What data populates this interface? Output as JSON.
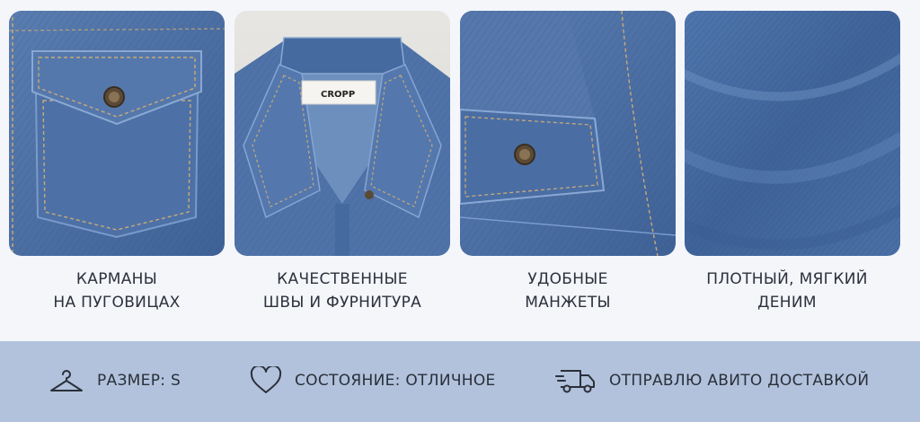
{
  "features": [
    {
      "icon": "pocket-image",
      "lines": [
        "КАРМАНЫ",
        "НА ПУГОВИЦАХ"
      ]
    },
    {
      "icon": "collar-image",
      "label_tag": "CROPP",
      "lines": [
        "КАЧЕСТВЕННЫЕ",
        "ШВЫ И ФУРНИТУРА"
      ]
    },
    {
      "icon": "cuff-image",
      "lines": [
        "УДОБНЫЕ",
        "МАНЖЕТЫ"
      ]
    },
    {
      "icon": "denim-texture-image",
      "lines": [
        "ПЛОТНЫЙ, МЯГКИЙ",
        "ДЕНИМ"
      ]
    }
  ],
  "info_bar": [
    {
      "icon": "hanger-icon",
      "text": "РАЗМЕР: S"
    },
    {
      "icon": "heart-icon",
      "text": "СОСТОЯНИЕ: ОТЛИЧНОЕ"
    },
    {
      "icon": "delivery-truck-icon",
      "text": "ОТПРАВЛЮ АВИТО ДОСТАВКОЙ"
    }
  ],
  "colors": {
    "denim": "#4f72a6",
    "denim_dark": "#38598a",
    "stitch": "#c9a978",
    "bottom_bar": "#b2c2dc",
    "background": "#f4f6fa"
  }
}
